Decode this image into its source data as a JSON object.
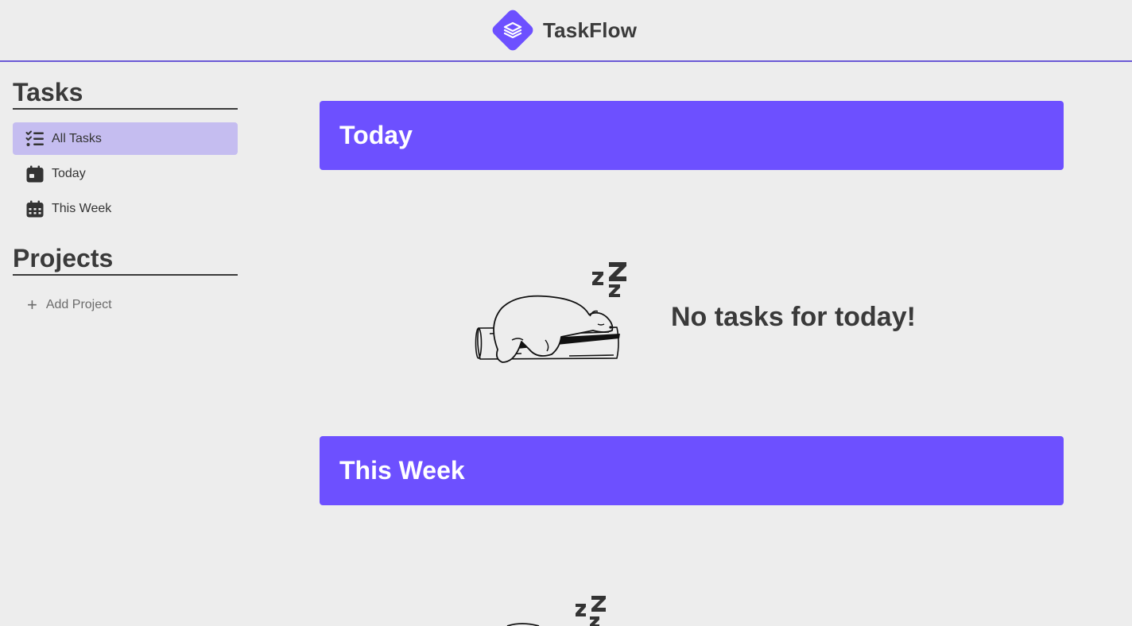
{
  "header": {
    "app_name": "TaskFlow",
    "logo_icon": "stack-layers-icon",
    "accent": "#6d50ff"
  },
  "sidebar": {
    "tasks_title": "Tasks",
    "items": [
      {
        "label": "All Tasks",
        "icon": "checklist-icon",
        "active": true
      },
      {
        "label": "Today",
        "icon": "calendar-day-icon",
        "active": false
      },
      {
        "label": "This Week",
        "icon": "calendar-week-icon",
        "active": false
      }
    ],
    "projects_title": "Projects",
    "add_project_label": "Add Project"
  },
  "main": {
    "sections": [
      {
        "title": "Today",
        "empty_message": "No tasks for today!"
      },
      {
        "title": "This Week"
      }
    ]
  }
}
